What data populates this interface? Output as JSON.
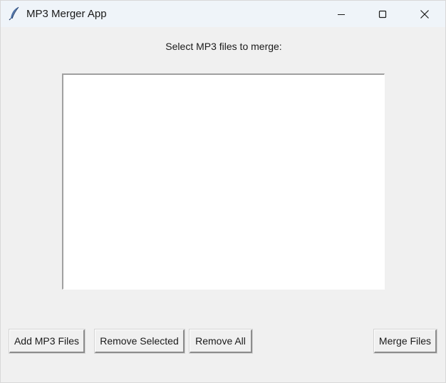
{
  "window": {
    "title": "MP3 Merger App",
    "icon": "feather-icon"
  },
  "titlebar": {
    "minimize_icon": "minimize-icon",
    "maximize_icon": "maximize-icon",
    "close_icon": "close-icon"
  },
  "main": {
    "prompt": "Select MP3 files to merge:",
    "file_list_items": []
  },
  "buttons": {
    "add": "Add MP3 Files",
    "remove_selected": "Remove Selected",
    "remove_all": "Remove All",
    "merge": "Merge Files"
  }
}
